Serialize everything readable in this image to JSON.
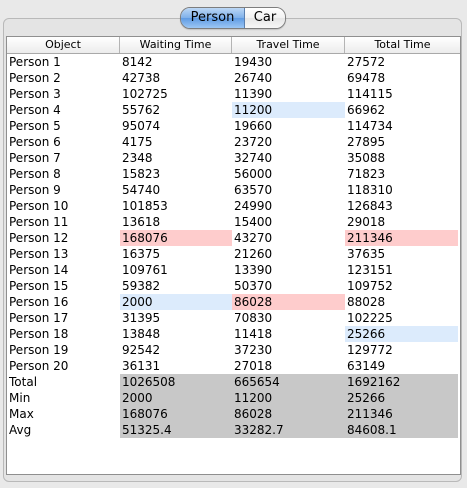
{
  "tabs": [
    {
      "label": "Person",
      "active": true
    },
    {
      "label": "Car",
      "active": false
    }
  ],
  "columns": [
    "Object",
    "Waiting Time",
    "Travel Time",
    "Total Time"
  ],
  "rows": [
    {
      "label": "Person 1",
      "values": [
        "8142",
        "19430",
        "27572"
      ],
      "hl": [
        "",
        "",
        ""
      ]
    },
    {
      "label": "Person 2",
      "values": [
        "42738",
        "26740",
        "69478"
      ],
      "hl": [
        "",
        "",
        ""
      ]
    },
    {
      "label": "Person 3",
      "values": [
        "102725",
        "11390",
        "114115"
      ],
      "hl": [
        "",
        "",
        ""
      ]
    },
    {
      "label": "Person 4",
      "values": [
        "55762",
        "11200",
        "66962"
      ],
      "hl": [
        "",
        "blue",
        ""
      ]
    },
    {
      "label": "Person 5",
      "values": [
        "95074",
        "19660",
        "114734"
      ],
      "hl": [
        "",
        "",
        ""
      ]
    },
    {
      "label": "Person 6",
      "values": [
        "4175",
        "23720",
        "27895"
      ],
      "hl": [
        "",
        "",
        ""
      ]
    },
    {
      "label": "Person 7",
      "values": [
        "2348",
        "32740",
        "35088"
      ],
      "hl": [
        "",
        "",
        ""
      ]
    },
    {
      "label": "Person 8",
      "values": [
        "15823",
        "56000",
        "71823"
      ],
      "hl": [
        "",
        "",
        ""
      ]
    },
    {
      "label": "Person 9",
      "values": [
        "54740",
        "63570",
        "118310"
      ],
      "hl": [
        "",
        "",
        ""
      ]
    },
    {
      "label": "Person 10",
      "values": [
        "101853",
        "24990",
        "126843"
      ],
      "hl": [
        "",
        "",
        ""
      ]
    },
    {
      "label": "Person 11",
      "values": [
        "13618",
        "15400",
        "29018"
      ],
      "hl": [
        "",
        "",
        ""
      ]
    },
    {
      "label": "Person 12",
      "values": [
        "168076",
        "43270",
        "211346"
      ],
      "hl": [
        "red",
        "",
        "red"
      ]
    },
    {
      "label": "Person 13",
      "values": [
        "16375",
        "21260",
        "37635"
      ],
      "hl": [
        "",
        "",
        ""
      ]
    },
    {
      "label": "Person 14",
      "values": [
        "109761",
        "13390",
        "123151"
      ],
      "hl": [
        "",
        "",
        ""
      ]
    },
    {
      "label": "Person 15",
      "values": [
        "59382",
        "50370",
        "109752"
      ],
      "hl": [
        "",
        "",
        ""
      ]
    },
    {
      "label": "Person 16",
      "values": [
        "2000",
        "86028",
        "88028"
      ],
      "hl": [
        "blue",
        "red",
        ""
      ]
    },
    {
      "label": "Person 17",
      "values": [
        "31395",
        "70830",
        "102225"
      ],
      "hl": [
        "",
        "",
        ""
      ]
    },
    {
      "label": "Person 18",
      "values": [
        "13848",
        "11418",
        "25266"
      ],
      "hl": [
        "",
        "",
        "blue"
      ]
    },
    {
      "label": "Person 19",
      "values": [
        "92542",
        "37230",
        "129772"
      ],
      "hl": [
        "",
        "",
        ""
      ]
    },
    {
      "label": "Person 20",
      "values": [
        "36131",
        "27018",
        "63149"
      ],
      "hl": [
        "",
        "",
        ""
      ]
    },
    {
      "label": "Total",
      "values": [
        "1026508",
        "665654",
        "1692162"
      ],
      "hl": [
        "gray",
        "gray",
        "gray"
      ]
    },
    {
      "label": "Min",
      "values": [
        "2000",
        "11200",
        "25266"
      ],
      "hl": [
        "gray",
        "gray",
        "gray"
      ]
    },
    {
      "label": "Max",
      "values": [
        "168076",
        "86028",
        "211346"
      ],
      "hl": [
        "gray",
        "gray",
        "gray"
      ]
    },
    {
      "label": "Avg",
      "values": [
        "51325.4",
        "33282.7",
        "84608.1"
      ],
      "hl": [
        "gray",
        "gray",
        "gray"
      ]
    }
  ],
  "colors": {
    "highlight_red": "#fecccc",
    "highlight_blue": "#dcebfc",
    "summary_gray": "#c8c8c8",
    "active_tab": "#7eb0ea"
  }
}
